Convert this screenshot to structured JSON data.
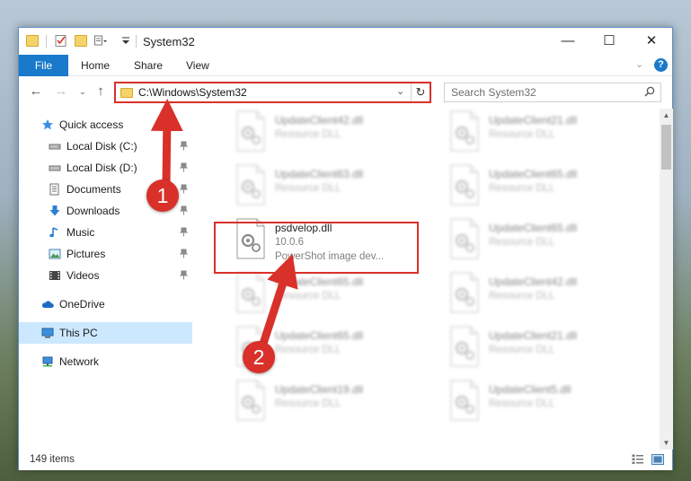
{
  "window": {
    "title": "System32",
    "minimize": "—",
    "maximize": "☐",
    "close": "✕"
  },
  "ribbon": {
    "tabs": [
      "File",
      "Home",
      "Share",
      "View"
    ],
    "help": "?"
  },
  "address": {
    "path": "C:\\Windows\\System32",
    "search_placeholder": "Search System32"
  },
  "nav": {
    "quick_access": "Quick access",
    "items": [
      {
        "label": "Local Disk (C:)",
        "icon": "drive-icon",
        "pinned": true
      },
      {
        "label": "Local Disk (D:)",
        "icon": "drive-icon",
        "pinned": true
      },
      {
        "label": "Documents",
        "icon": "documents-icon",
        "pinned": true
      },
      {
        "label": "Downloads",
        "icon": "downloads-icon",
        "pinned": true
      },
      {
        "label": "Music",
        "icon": "music-icon",
        "pinned": true
      },
      {
        "label": "Pictures",
        "icon": "pictures-icon",
        "pinned": true
      },
      {
        "label": "Videos",
        "icon": "videos-icon",
        "pinned": true
      }
    ],
    "onedrive": "OneDrive",
    "this_pc": "This PC",
    "network": "Network"
  },
  "files": [
    {
      "name": "UpdateClient42.dll",
      "type": "Resource DLL",
      "blurred": true
    },
    {
      "name": "UpdateClient21.dll",
      "type": "Resource DLL",
      "blurred": true
    },
    {
      "name": "UpdateClient63.dll",
      "type": "Resource DLL",
      "blurred": true
    },
    {
      "name": "UpdateClient65.dll",
      "type": "Resource DLL",
      "blurred": true
    },
    {
      "name": "psdvelop.dll",
      "version": "10.0.6",
      "type": "PowerShot image dev...",
      "blurred": false
    },
    {
      "name": "UpdateClient65.dll",
      "type": "Resource DLL",
      "blurred": true
    },
    {
      "name": "UpdateClient65.dll",
      "type": "Resource DLL",
      "blurred": true
    },
    {
      "name": "UpdateClient42.dll",
      "type": "Resource DLL",
      "blurred": true
    },
    {
      "name": "UpdateClient65.dll",
      "type": "Resource DLL",
      "blurred": true
    },
    {
      "name": "UpdateClient21.dll",
      "type": "Resource DLL",
      "blurred": true
    },
    {
      "name": "UpdateClient19.dll",
      "type": "Resource DLL",
      "blurred": true
    },
    {
      "name": "UpdateClient5.dll",
      "type": "Resource DLL",
      "blurred": true
    }
  ],
  "status": {
    "items_count": "149 items"
  },
  "annotations": {
    "step1": "1",
    "step2": "2",
    "color": "#d9302a"
  }
}
